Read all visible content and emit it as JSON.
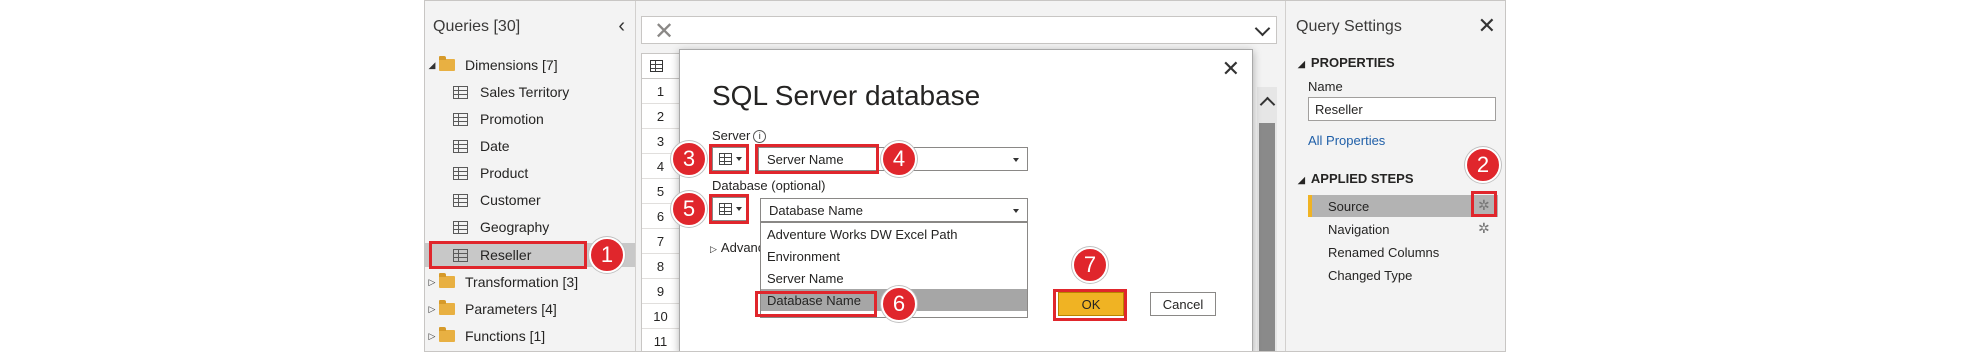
{
  "queries": {
    "title": "Queries [30]",
    "collapse_glyph": "‹",
    "items": [
      {
        "label": "Dimensions [7]",
        "kind": "folder",
        "expanded": true
      },
      {
        "label": "Sales Territory",
        "kind": "table"
      },
      {
        "label": "Promotion",
        "kind": "table"
      },
      {
        "label": "Date",
        "kind": "table"
      },
      {
        "label": "Product",
        "kind": "table"
      },
      {
        "label": "Customer",
        "kind": "table"
      },
      {
        "label": "Geography",
        "kind": "table"
      },
      {
        "label": "Reseller",
        "kind": "table",
        "selected": true
      },
      {
        "label": "Transformation [3]",
        "kind": "folder"
      },
      {
        "label": "Parameters [4]",
        "kind": "folder"
      },
      {
        "label": "Functions [1]",
        "kind": "folder"
      }
    ]
  },
  "formula_bar": {
    "cancel_glyph": "✕"
  },
  "grid": {
    "row_numbers": [
      "1",
      "2",
      "3",
      "4",
      "5",
      "6",
      "7",
      "8",
      "9",
      "10",
      "11"
    ]
  },
  "dialog": {
    "title": "SQL Server database",
    "close_glyph": "✕",
    "server_label": "Server",
    "server_value": "Server Name",
    "database_label": "Database (optional)",
    "database_value": "Database Name",
    "dropdown_options": [
      "Adventure Works DW Excel Path",
      "Environment",
      "Server Name",
      "Database Name"
    ],
    "dropdown_highlighted": "Database Name",
    "advanced_label": "Advanced options",
    "ok_label": "OK",
    "cancel_label": "Cancel"
  },
  "settings": {
    "title": "Query Settings",
    "close_glyph": "✕",
    "properties_header": "PROPERTIES",
    "name_label": "Name",
    "name_value": "Reseller",
    "all_properties_link": "All Properties",
    "applied_steps_header": "APPLIED STEPS",
    "steps": [
      "Source",
      "Navigation",
      "Renamed Columns",
      "Changed Type"
    ]
  },
  "callouts": [
    "1",
    "2",
    "3",
    "4",
    "5",
    "6",
    "7"
  ],
  "colors": {
    "callout_red": "#e0262c",
    "ok_yellow": "#f0b323",
    "link_blue": "#1f5fa8"
  }
}
